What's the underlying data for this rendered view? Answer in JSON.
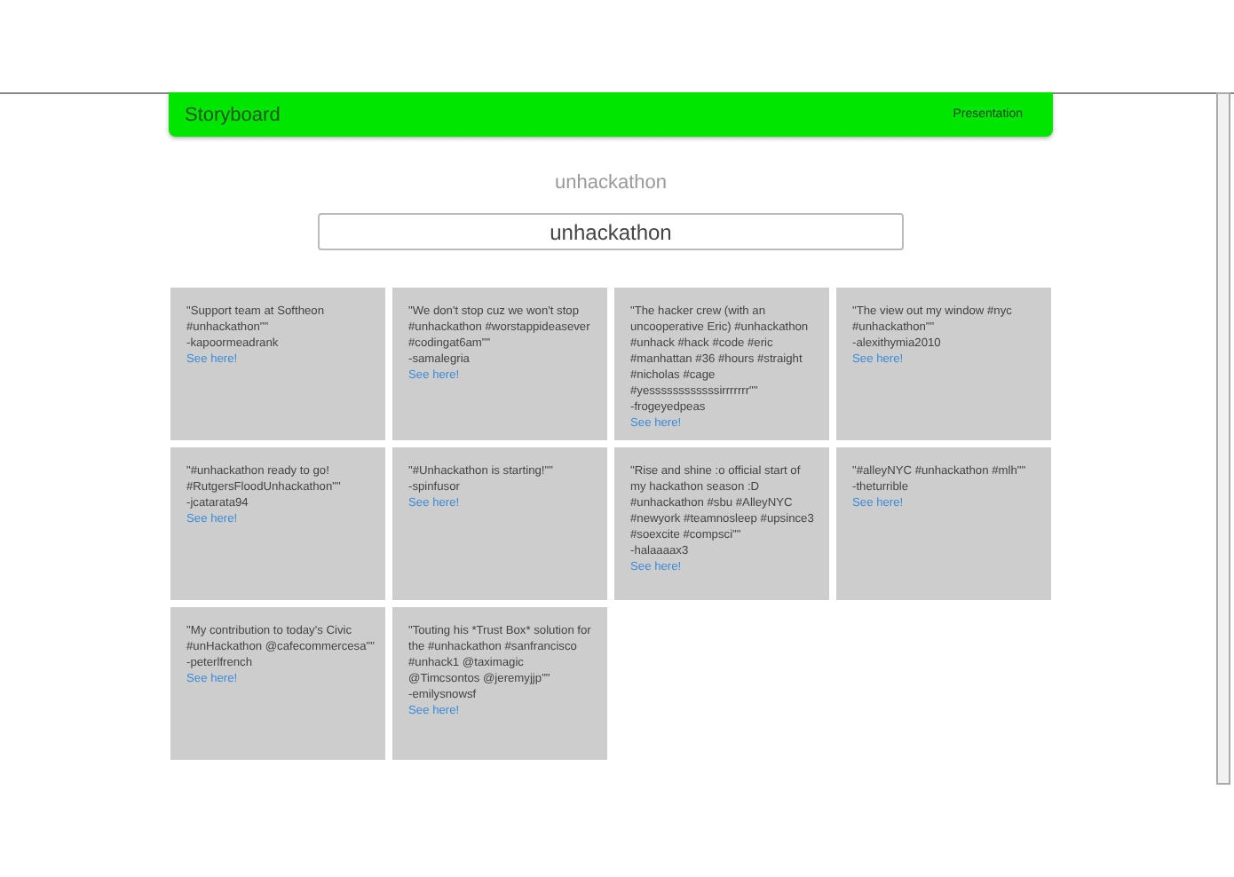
{
  "navbar": {
    "brand": "Storyboard",
    "link": "Presentation"
  },
  "heading": "unhackathon",
  "search": {
    "value": "unhackathon"
  },
  "tweets": [
    {
      "text": "\"Support team at Softheon #unhackathon\"\"",
      "author": "-kapoormeadrank",
      "link": "See here!"
    },
    {
      "text": "\"We don't stop cuz we won't stop #unhackathon #worstappideasever #codingat6am\"\"",
      "author": "-samalegria",
      "link": "See here!"
    },
    {
      "text": "\"The hacker crew (with an uncooperative Eric) #unhackathon #unhack #hack #code #eric #manhattan #36 #hours #straight #nicholas #cage #yessssssssssssirrrrrrr\"\"",
      "author": "-frogeyedpeas",
      "link": "See here!"
    },
    {
      "text": "\"The view out my window #nyc #unhackathon\"\"",
      "author": "-alexithymia2010",
      "link": "See here!"
    },
    {
      "text": "\"#unhackathon ready to go! #RutgersFloodUnhackathon\"\"",
      "author": "-jcatarata94",
      "link": "See here!"
    },
    {
      "text": "\"#Unhackathon is starting!\"\"",
      "author": "-spinfusor",
      "link": "See here!"
    },
    {
      "text": "\"Rise and shine :o official start of my hackathon season :D #unhackathon #sbu #AlleyNYC #newyork #teamnosleep #upsince3 #soexcite #compsci\"\"",
      "author": "-halaaaax3",
      "link": "See here!"
    },
    {
      "text": "\"#alleyNYC #unhackathon #mlh\"\"",
      "author": "-theturrible",
      "link": "See here!"
    },
    {
      "text": "\"My contribution to today's Civic #unHackathon @cafecommercesa\"\"",
      "author": "-peterlfrench",
      "link": "See here!"
    },
    {
      "text": "\"Touting his *Trust Box* solution for the #unhackathon #sanfrancisco #unhack1 @taximagic @Timcsontos @jeremyjjp\"\"",
      "author": "-emilysnowsf",
      "link": "See here!"
    }
  ]
}
